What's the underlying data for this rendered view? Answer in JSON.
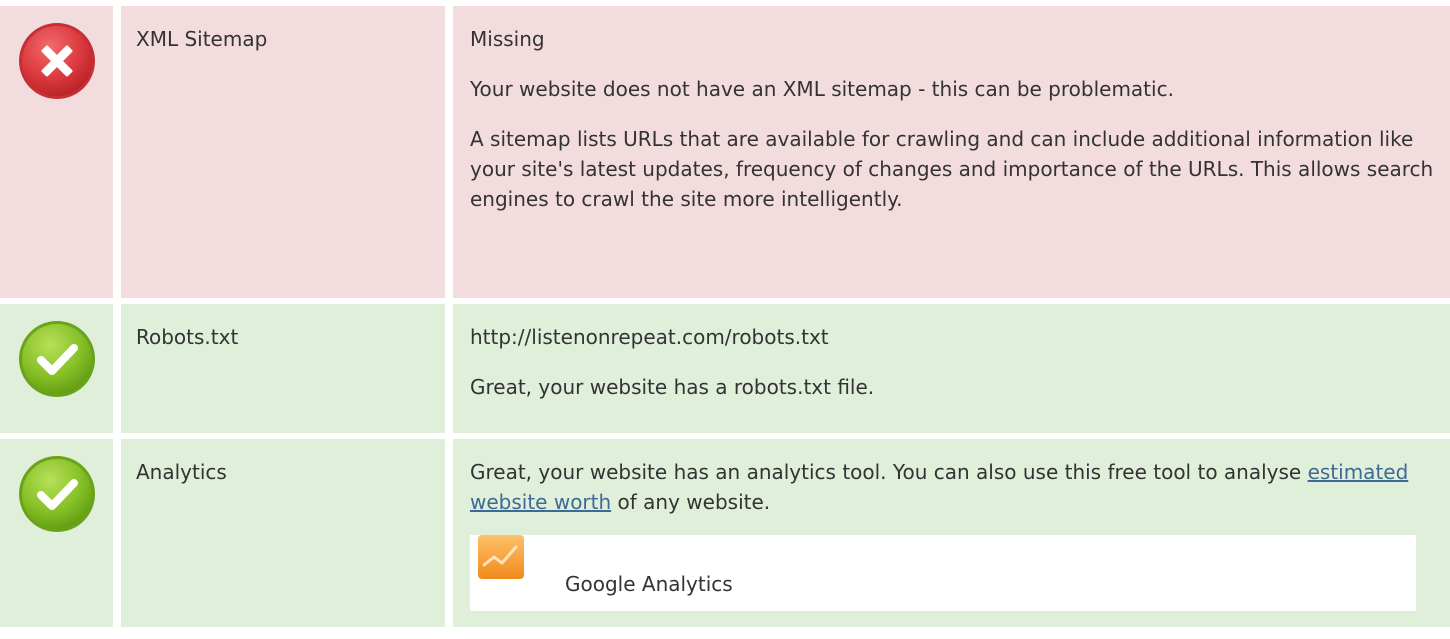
{
  "rows": [
    {
      "status": "fail",
      "icon": "error-x-icon",
      "label": "XML Sitemap",
      "value": "Missing",
      "paragraphs": [
        "Your website does not have an XML sitemap - this can be problematic.",
        "A sitemap lists URLs that are available for crawling and can include additional information like your site's latest updates, frequency of changes and importance of the URLs. This allows search engines to crawl the site more intelligently."
      ]
    },
    {
      "status": "pass",
      "icon": "success-check-icon",
      "label": "Robots.txt",
      "value": "http://listenonrepeat.com/robots.txt",
      "paragraphs": [
        "Great, your website has a robots.txt file."
      ]
    },
    {
      "status": "pass",
      "icon": "success-check-icon",
      "label": "Analytics",
      "text_before_link": "Great, your website has an analytics tool. You can also use this free tool to analyse ",
      "link_text": "estimated website worth",
      "text_after_link": " of any website.",
      "tool": {
        "name": "Google Analytics",
        "icon": "google-analytics-logo"
      }
    }
  ],
  "colors": {
    "fail_bg": "#f3dcdd",
    "pass_bg": "#e0efda",
    "error_red": "#d9363a",
    "success_green": "#7cbb1f",
    "link": "#3d6a96",
    "analytics_orange": "#f7a33c"
  }
}
